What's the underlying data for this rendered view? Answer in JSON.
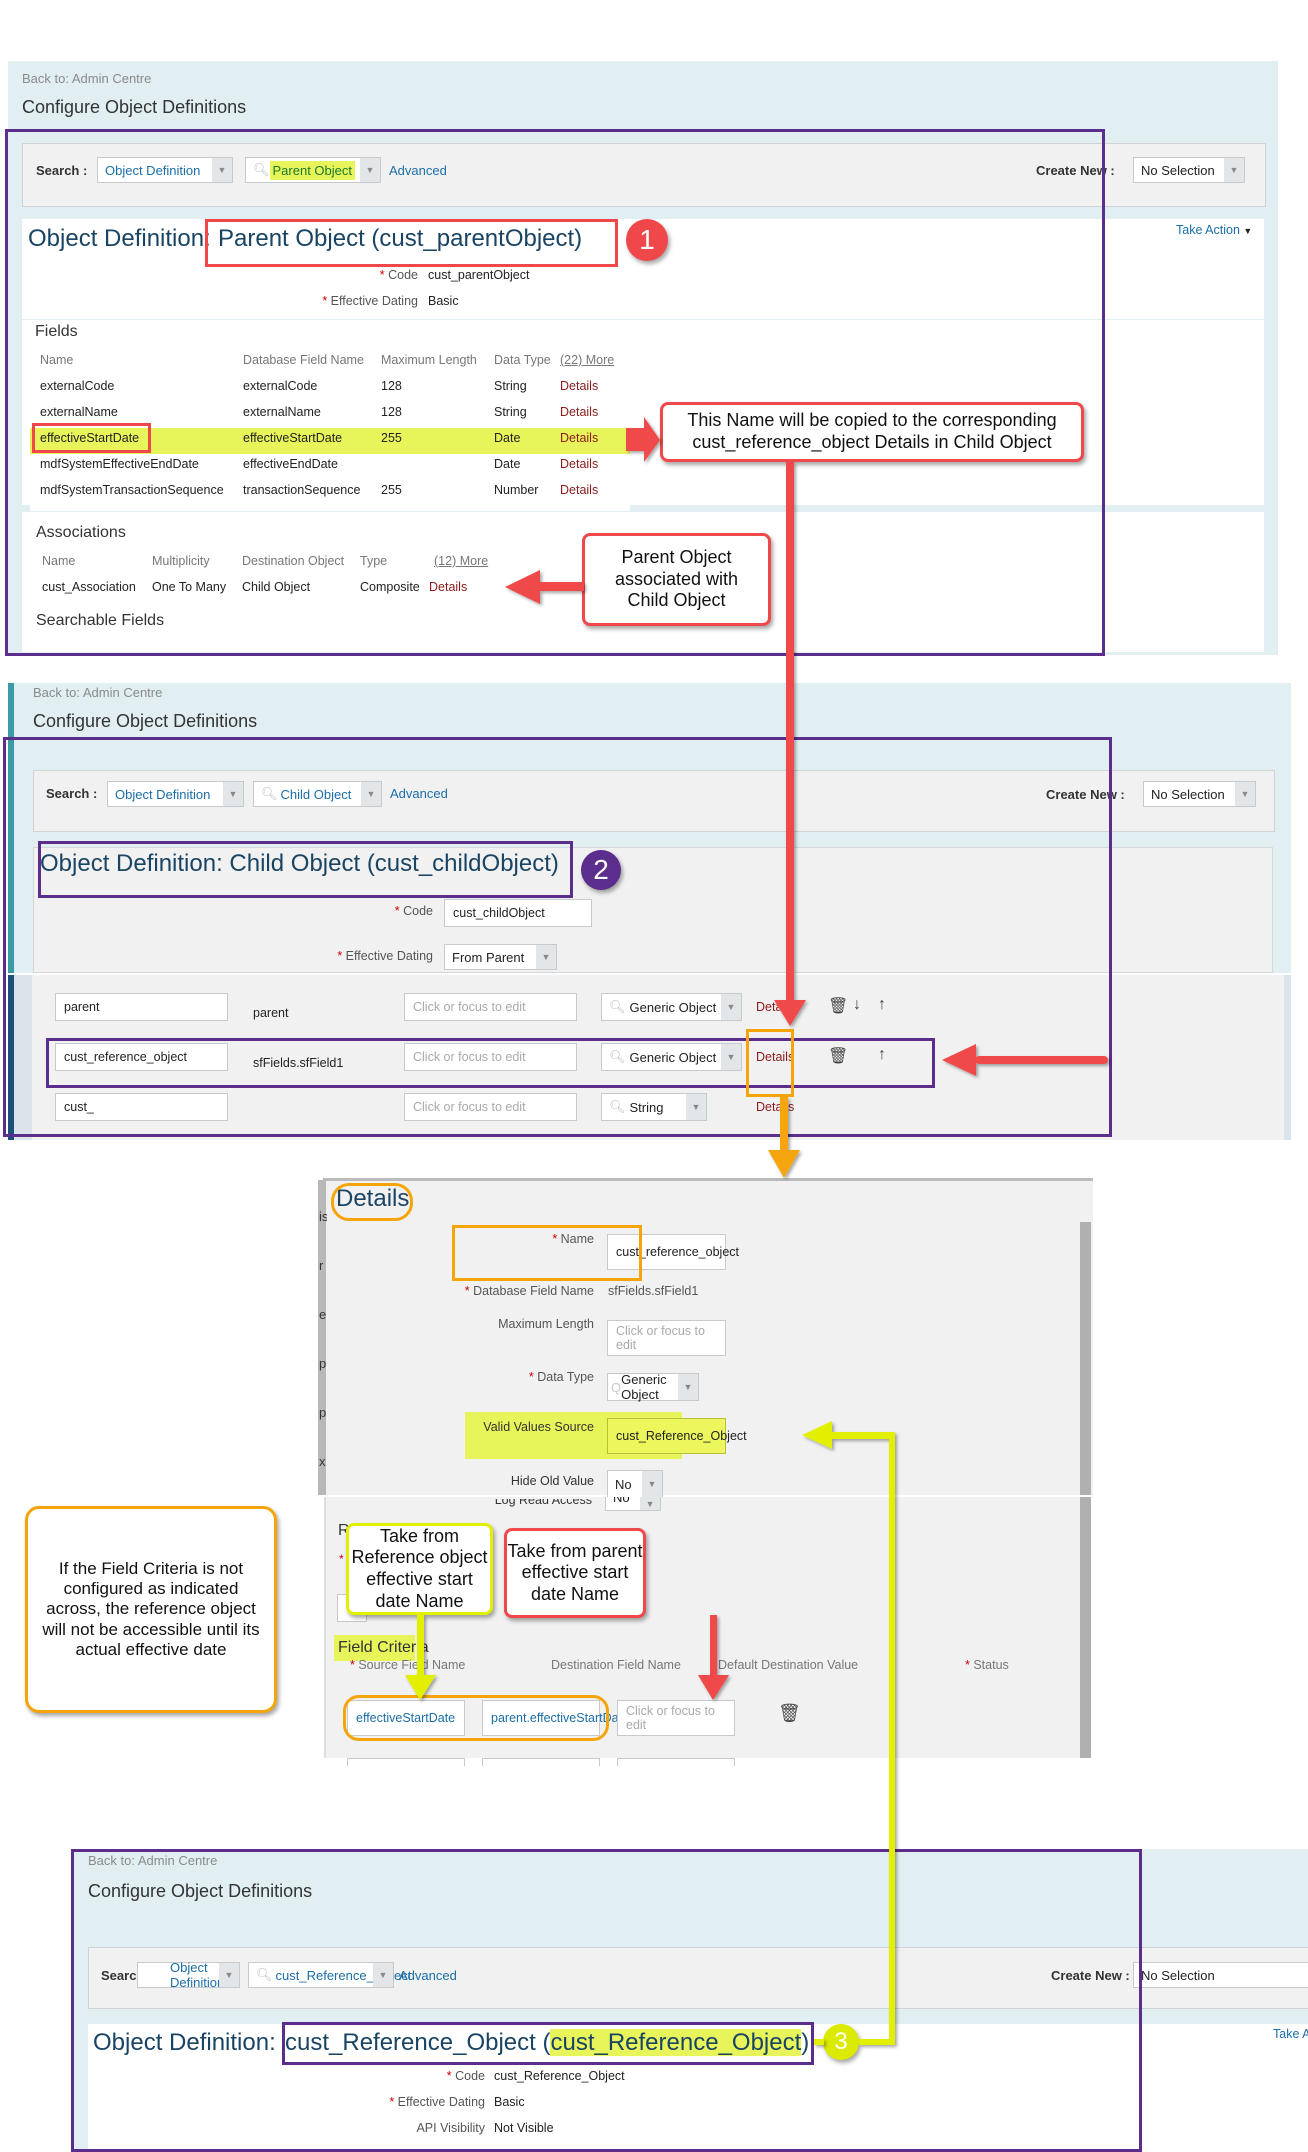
{
  "panel1": {
    "breadcrumb": "Back to: Admin Centre",
    "page_title": "Configure Object Definitions",
    "search_label": "Search :",
    "search_type": "Object Definition",
    "search_value": "Parent Object",
    "advanced_link": "Advanced",
    "create_new_label": "Create New :",
    "create_new_value": "No Selection",
    "heading_prefix": "Object Definition:",
    "heading_name": "Parent Object (cust_parentObject)",
    "take_action": "Take Action",
    "badge": "1",
    "code_label": "Code",
    "code_value": "cust_parentObject",
    "effdating_label": "Effective Dating",
    "effdating_value": "Basic",
    "fields_title": "Fields",
    "fields_columns": [
      "Name",
      "Database Field Name",
      "Maximum Length",
      "Data Type",
      "(22) More"
    ],
    "fields_rows": [
      {
        "name": "externalCode",
        "db": "externalCode",
        "maxlen": "128",
        "type": "String",
        "action": "Details"
      },
      {
        "name": "externalName",
        "db": "externalName",
        "maxlen": "128",
        "type": "String",
        "action": "Details"
      },
      {
        "name": "effectiveStartDate",
        "db": "effectiveStartDate",
        "maxlen": "255",
        "type": "Date",
        "action": "Details"
      },
      {
        "name": "mdfSystemEffectiveEndDate",
        "db": "effectiveEndDate",
        "maxlen": "",
        "type": "Date",
        "action": "Details"
      },
      {
        "name": "mdfSystemTransactionSequence",
        "db": "transactionSequence",
        "maxlen": "255",
        "type": "Number",
        "action": "Details"
      }
    ],
    "associations_title": "Associations",
    "assoc_columns": [
      "Name",
      "Multiplicity",
      "Destination Object",
      "Type",
      "(12) More"
    ],
    "assoc_rows": [
      {
        "name": "cust_Association",
        "multiplicity": "One To Many",
        "destination": "Child Object",
        "type": "Composite",
        "action": "Details"
      }
    ],
    "searchable_title": "Searchable Fields"
  },
  "panel2": {
    "breadcrumb": "Back to: Admin Centre",
    "page_title": "Configure Object Definitions",
    "search_label": "Search :",
    "search_type": "Object Definition",
    "search_value": "Child Object",
    "advanced_link": "Advanced",
    "create_new_label": "Create New :",
    "create_new_value": "No Selection",
    "heading": "Object Definition: Child Object (cust_childObject)",
    "badge": "2",
    "code_label": "Code",
    "code_value": "cust_childObject",
    "effdating_label": "Effective Dating",
    "effdating_value": "From Parent",
    "field_rows": [
      {
        "name": "parent",
        "db": "parent",
        "maxlen_placeholder": "Click or focus to edit",
        "type": "Generic Object",
        "action": "Details"
      },
      {
        "name": "cust_reference_object",
        "db": "sfFields.sfField1",
        "maxlen_placeholder": "Click or focus to edit",
        "type": "Generic Object",
        "action": "Details"
      },
      {
        "name": "cust_",
        "db": "",
        "maxlen_placeholder": "Click or focus to edit",
        "type": "String",
        "action": "Details"
      }
    ]
  },
  "details": {
    "title": "Details",
    "name_label": "Name",
    "name_value": "cust_reference_object",
    "dbfield_label": "Database Field Name",
    "dbfield_value": "sfFields.sfField1",
    "maxlen_label": "Maximum Length",
    "maxlen_placeholder": "Click or focus to edit",
    "datatype_label": "Data Type",
    "datatype_value": "Generic Object",
    "valid_source_label": "Valid Values Source",
    "valid_source_value": "cust_Reference_Object",
    "hide_old_label": "Hide Old Value",
    "hide_old_value": "No",
    "log_read_label": "Log Read Access",
    "log_read_value": "No",
    "rules_label": "Rul",
    "field_criteria_title": "Field Criteria",
    "criteria_columns": [
      "Source Field Name",
      "Destination Field Name",
      "Default Destination Value",
      "Status"
    ],
    "criteria_row": {
      "source": "effectiveStartDate",
      "destination": "parent.effectiveStartDate",
      "default_placeholder": "Click or focus to edit"
    }
  },
  "panel3": {
    "breadcrumb": "Back to: Admin Centre",
    "page_title": "Configure Object Definitions",
    "search_label": "Search :",
    "search_type": "Object Definition",
    "search_value": "cust_Reference_Object",
    "advanced_link": "Advanced",
    "create_new_label": "Create New :",
    "create_new_value": "No Selection",
    "heading_prefix": "Object Definition:",
    "heading_name": "cust_Reference_Object (",
    "heading_code": "cust_Reference_Object",
    "heading_close": ")",
    "take_action": "Take Actic",
    "badge": "3",
    "code_label": "Code",
    "code_value": "cust_Reference_Object",
    "effdating_label": "Effective Dating",
    "effdating_value": "Basic",
    "api_label": "API Visibility",
    "api_value": "Not Visible"
  },
  "annotations": {
    "copy_note": "This Name will be copied to the corresponding cust_reference_object Details in Child Object",
    "assoc_note": "Parent Object associated with Child Object",
    "ref_note": "Take from Reference object effective start date Name",
    "parent_note": "Take from parent effective start date Name",
    "warning_note": "If the Field Criteria is not configured as indicated across, the reference object will not be accessible until its actual effective date"
  },
  "colors": {
    "accent_purple": "#5b2d8c",
    "callout_red": "#f0484a",
    "callout_orange": "#f5a50a",
    "highlight_yellow": "#e8f55a",
    "link_blue": "#1b6ea8",
    "details_link": "#8b1a1a"
  }
}
